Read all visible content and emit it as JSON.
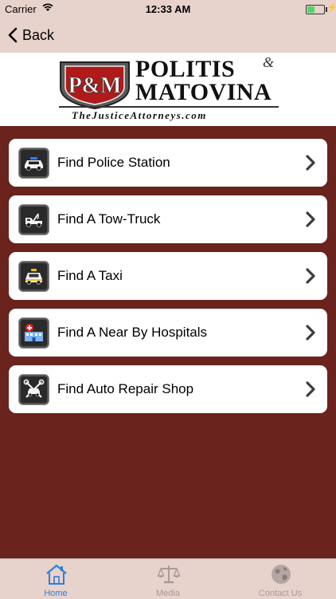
{
  "status": {
    "carrier": "Carrier",
    "time": "12:33 AM"
  },
  "nav": {
    "back_label": "Back"
  },
  "logo": {
    "badge": "P&M",
    "line1": "POLITIS",
    "amp": "&",
    "line2": "MATOVINA",
    "site": "TheJusticeAttorneys.com"
  },
  "menu": [
    {
      "label": "Find Police Station",
      "icon": "police-car-icon"
    },
    {
      "label": "Find A Tow-Truck",
      "icon": "tow-truck-icon"
    },
    {
      "label": "Find A Taxi",
      "icon": "taxi-icon"
    },
    {
      "label": "Find A Near By Hospitals",
      "icon": "hospital-icon"
    },
    {
      "label": "Find Auto Repair Shop",
      "icon": "auto-repair-icon"
    }
  ],
  "tabs": [
    {
      "label": "Home",
      "icon": "home-icon",
      "active": true,
      "color": "#2a7fd8"
    },
    {
      "label": "Media",
      "icon": "scales-icon",
      "active": false,
      "color": "#a89a97"
    },
    {
      "label": "Contact Us",
      "icon": "globe-icon",
      "active": false,
      "color": "#a89a97"
    }
  ],
  "colors": {
    "background": "#6a231d",
    "bar": "#e8d2cc",
    "accent": "#2a7fd8"
  }
}
